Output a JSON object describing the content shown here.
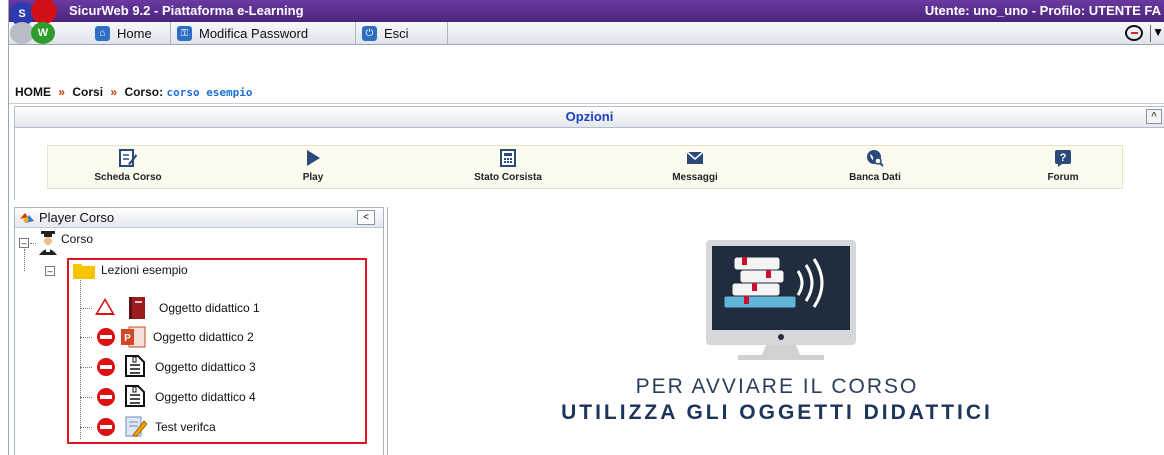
{
  "window": {
    "app_title": "SicurWeb 9.2 - Piattaforma e-Learning",
    "user_info": "Utente: uno_uno - Profilo: UTENTE FA"
  },
  "logo": {
    "letter_s": "S",
    "letter_w": "W"
  },
  "menubar": {
    "items": [
      {
        "label": "Home",
        "icon": "home-icon"
      },
      {
        "label": "Modifica Password",
        "icon": "key-icon"
      },
      {
        "label": "Esci",
        "icon": "power-icon"
      }
    ]
  },
  "breadcrumb": {
    "home": "HOME",
    "sep": "»",
    "corsi": "Corsi",
    "corso_label": "Corso:",
    "current": "corso esempio"
  },
  "options": {
    "title": "Opzioni"
  },
  "toolbar": {
    "items": [
      {
        "label": "Scheda Corso",
        "icon": "edit-doc-icon"
      },
      {
        "label": "Play",
        "icon": "play-icon"
      },
      {
        "label": "Stato Corsista",
        "icon": "calculator-doc-icon"
      },
      {
        "label": "Messaggi",
        "icon": "envelope-icon"
      },
      {
        "label": "Banca Dati",
        "icon": "globe-search-icon"
      },
      {
        "label": "Forum",
        "icon": "question-icon"
      }
    ]
  },
  "player": {
    "title": "Player Corso",
    "tree": {
      "root": "Corso",
      "folder": "Lezioni esempio",
      "items": [
        {
          "label": "Oggetto didattico 1",
          "status": "warning",
          "type": "book"
        },
        {
          "label": "Oggetto didattico 2",
          "status": "blocked",
          "type": "powerpoint"
        },
        {
          "label": "Oggetto didattico 3",
          "status": "blocked",
          "type": "document"
        },
        {
          "label": "Oggetto didattico 4",
          "status": "blocked",
          "type": "document"
        },
        {
          "label": "Test verifca",
          "status": "blocked",
          "type": "test"
        }
      ]
    }
  },
  "content": {
    "line1": "PER AVVIARE IL CORSO",
    "line2": "UTILIZZA GLI OGGETTI DIDATTICI"
  },
  "colors": {
    "title_bar": "#5a2d91",
    "accent_blue": "#1c3fc4",
    "highlight": "#e0141e",
    "stop_red": "#d11111"
  }
}
